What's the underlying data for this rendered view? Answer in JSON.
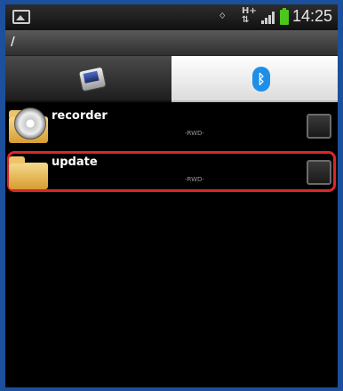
{
  "status_bar": {
    "time": "14:25",
    "icons": [
      "image-notification-icon",
      "bluetooth-icon",
      "hplus-data-icon",
      "signal-icon",
      "battery-icon"
    ],
    "hplus": "H+",
    "battery_color": "#4cc81c"
  },
  "path": "/",
  "tabs": [
    {
      "icon": "phone-storage-icon",
      "selected": false
    },
    {
      "icon": "bluetooth-icon",
      "selected": true
    }
  ],
  "files": [
    {
      "name": "recorder",
      "attr": "-RWD-",
      "icon": "disk-folder-icon",
      "highlighted": false
    },
    {
      "name": "update",
      "attr": "-RWD-",
      "icon": "folder-icon",
      "highlighted": true
    }
  ],
  "colors": {
    "frame": "#1c4f9c",
    "highlight": "#d8282a",
    "bluetooth": "#1e8fe8"
  }
}
